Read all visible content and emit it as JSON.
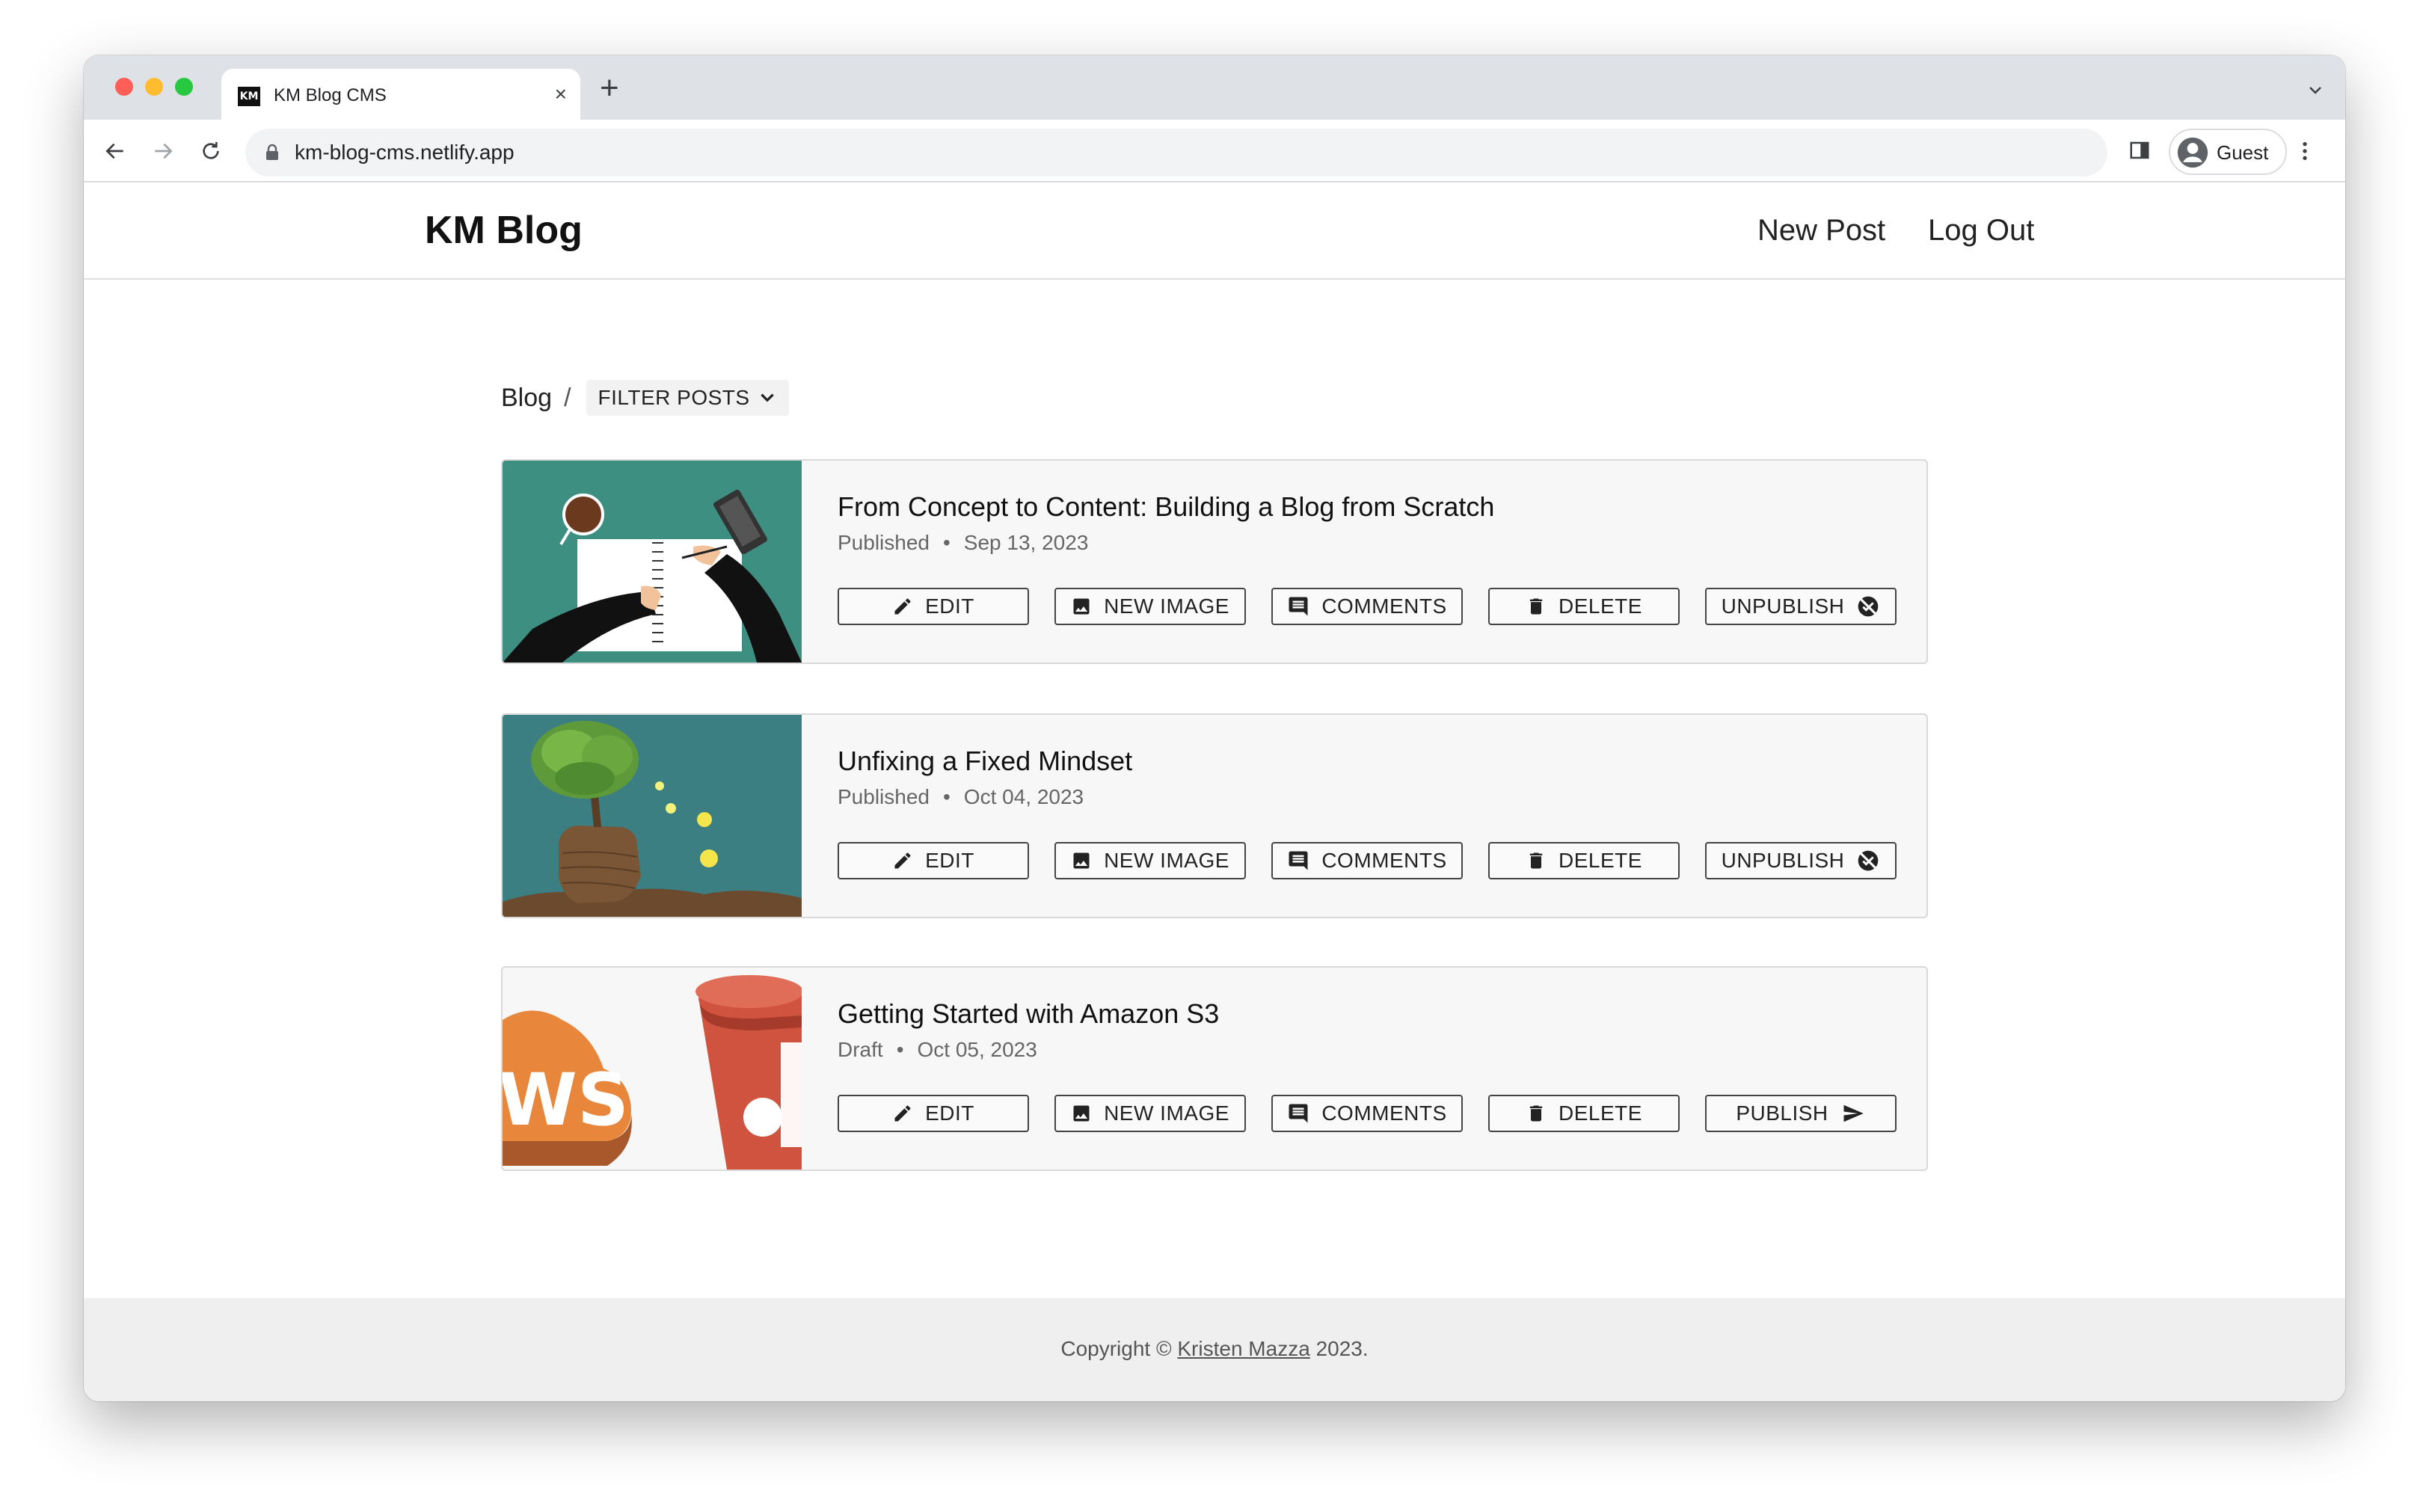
{
  "browser": {
    "tab_title": "KM Blog CMS",
    "favicon_text": "KM",
    "url": "km-blog-cms.netlify.app",
    "profile_label": "Guest"
  },
  "site": {
    "brand": "KM Blog",
    "nav": {
      "new_post": "New Post",
      "log_out": "Log Out"
    }
  },
  "breadcrumb": {
    "root": "Blog",
    "separator": "/",
    "filter_label": "FILTER POSTS"
  },
  "posts": [
    {
      "title": "From Concept to Content: Building a Blog from Scratch",
      "status": "Published",
      "date": "Sep 13, 2023",
      "thumbnail": "hands-writing-notebook-illustration",
      "actions": {
        "edit": "EDIT",
        "new_image": "NEW IMAGE",
        "comments": "COMMENTS",
        "delete": "DELETE",
        "toggle": "UNPUBLISH"
      }
    },
    {
      "title": "Unfixing a Fixed Mindset",
      "status": "Published",
      "date": "Oct 04, 2023",
      "thumbnail": "brain-tree-head-illustration",
      "actions": {
        "edit": "EDIT",
        "new_image": "NEW IMAGE",
        "comments": "COMMENTS",
        "delete": "DELETE",
        "toggle": "UNPUBLISH"
      }
    },
    {
      "title": "Getting Started with Amazon S3",
      "status": "Draft",
      "date": "Oct 05, 2023",
      "thumbnail": "aws-s3-bucket-illustration",
      "thumbnail_text": "WS",
      "actions": {
        "edit": "EDIT",
        "new_image": "NEW IMAGE",
        "comments": "COMMENTS",
        "delete": "DELETE",
        "toggle": "PUBLISH"
      }
    }
  ],
  "footer": {
    "prefix": "Copyright ©",
    "author": "Kristen Mazza",
    "suffix": "2023."
  },
  "colors": {
    "tabstrip": "#dee1e6",
    "card_bg": "#f7f7f7",
    "footer_bg": "#efefef",
    "thumb1_bg": "#3d8f82",
    "thumb2_bg": "#3b7f82",
    "aws_orange": "#e8873c",
    "s3_red": "#d0533f"
  }
}
